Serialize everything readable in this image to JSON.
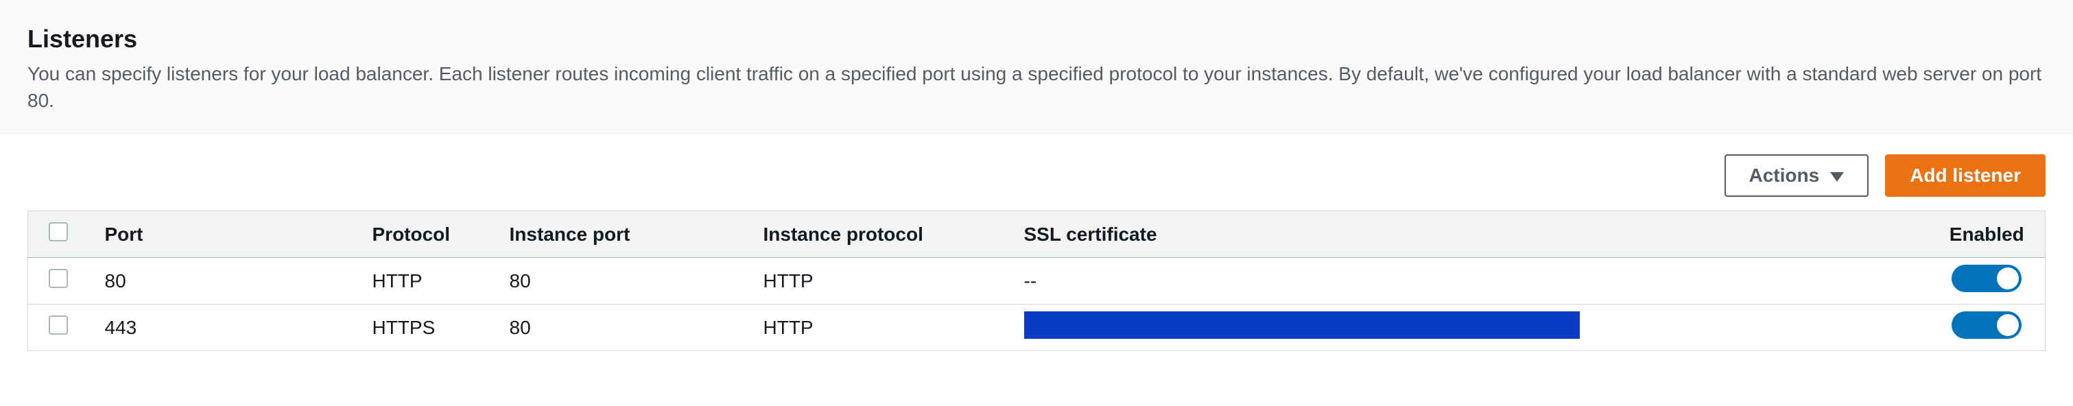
{
  "header": {
    "title": "Listeners",
    "description": "You can specify listeners for your load balancer. Each listener routes incoming client traffic on a specified port using a specified protocol to your instances. By default, we've configured your load balancer with a standard web server on port 80."
  },
  "toolbar": {
    "actions_label": "Actions",
    "add_label": "Add listener"
  },
  "table": {
    "headers": {
      "port": "Port",
      "protocol": "Protocol",
      "instance_port": "Instance port",
      "instance_protocol": "Instance protocol",
      "ssl_certificate": "SSL certificate",
      "enabled": "Enabled"
    },
    "rows": [
      {
        "port": "80",
        "protocol": "HTTP",
        "instance_port": "80",
        "instance_protocol": "HTTP",
        "ssl": "--",
        "ssl_redacted": false,
        "enabled": true
      },
      {
        "port": "443",
        "protocol": "HTTPS",
        "instance_port": "80",
        "instance_protocol": "HTTP",
        "ssl": "",
        "ssl_redacted": true,
        "enabled": true
      }
    ]
  }
}
